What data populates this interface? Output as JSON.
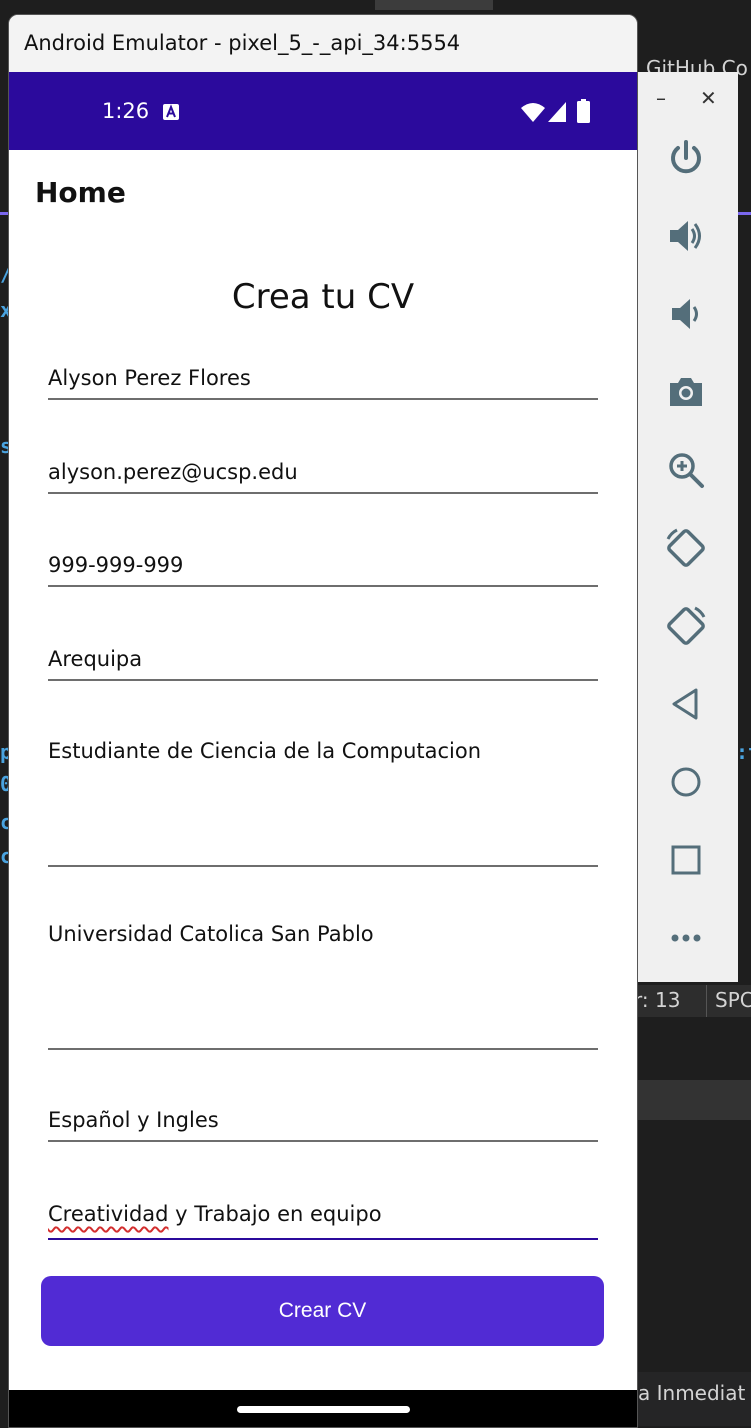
{
  "window": {
    "title": "Android Emulator - pixel_5_-_api_34:5554"
  },
  "status_bar": {
    "time": "1:26"
  },
  "app": {
    "nav_title": "Home",
    "heading": "Crea tu CV",
    "fields": {
      "name": "Alyson Perez Flores",
      "email": "alyson.perez@ucsp.edu",
      "phone": "999-999-999",
      "city": "Arequipa",
      "profile": "Estudiante de Ciencia de la Computacion",
      "education": "Universidad Catolica San Pablo",
      "languages": "Español y Ingles",
      "skills_misspelled": "Creatividad",
      "skills_rest": " y Trabajo en equipo"
    },
    "button_label": "Crear CV"
  },
  "toolbar": {
    "minimize": "–",
    "close": "✕",
    "icons": [
      "power-icon",
      "volume-up-icon",
      "volume-down-icon",
      "camera-icon",
      "zoom-icon",
      "rotate-left-icon",
      "rotate-right-icon",
      "back-icon",
      "home-icon",
      "overview-icon",
      "more-icon"
    ]
  },
  "background_ide": {
    "top_right_text": "GitHub Co",
    "line_label": "r: 13",
    "encoding": "SPC",
    "bottom_text": "a Inmediat",
    "left_fragments": [
      "/",
      "x",
      "s",
      "p",
      "0",
      "c",
      "c"
    ],
    "right_fragment": ":t"
  }
}
